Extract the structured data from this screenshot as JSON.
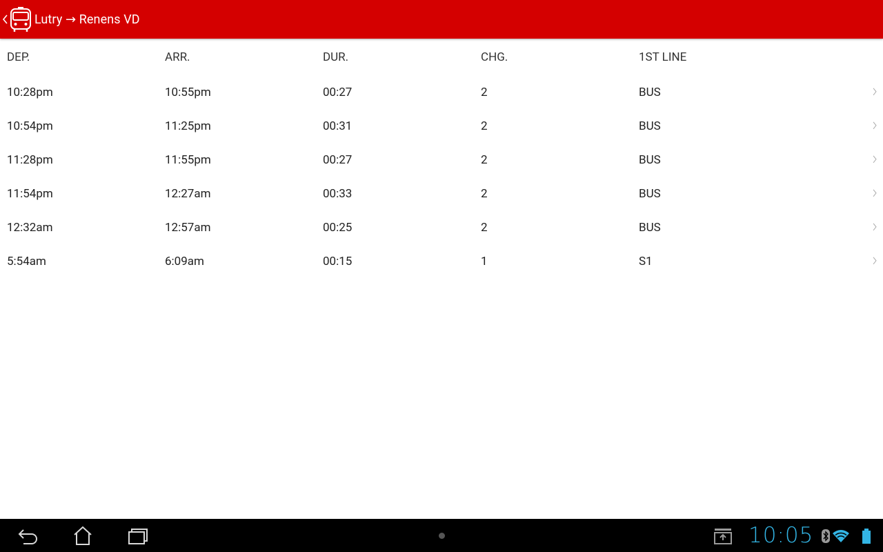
{
  "action_bar": {
    "title": "Lutry → Renens VD",
    "background_color": "#d40000",
    "up_icon": "chevron-left-icon",
    "logo_icon": "bus-icon"
  },
  "table": {
    "headers": [
      "DEP.",
      "ARR.",
      "DUR.",
      "CHG.",
      "1ST LINE"
    ],
    "rows": [
      {
        "dep": "10:28pm",
        "arr": "10:55pm",
        "dur": "00:27",
        "chg": "2",
        "line": "BUS"
      },
      {
        "dep": "10:54pm",
        "arr": "11:25pm",
        "dur": "00:31",
        "chg": "2",
        "line": "BUS"
      },
      {
        "dep": "11:28pm",
        "arr": "11:55pm",
        "dur": "00:27",
        "chg": "2",
        "line": "BUS"
      },
      {
        "dep": "11:54pm",
        "arr": "12:27am",
        "dur": "00:33",
        "chg": "2",
        "line": "BUS"
      },
      {
        "dep": "12:32am",
        "arr": "12:57am",
        "dur": "00:25",
        "chg": "2",
        "line": "BUS"
      },
      {
        "dep": "5:54am",
        "arr": "6:09am",
        "dur": "00:15",
        "chg": "1",
        "line": "S1"
      }
    ],
    "row_icon": "chevron-right-icon"
  },
  "system_bar": {
    "clock": "10:05",
    "clock_color": "#33b5e5",
    "icons": [
      "back-icon",
      "home-icon",
      "recent-apps-icon",
      "download-notification-icon",
      "bluetooth-icon",
      "wifi-icon",
      "battery-icon"
    ]
  }
}
